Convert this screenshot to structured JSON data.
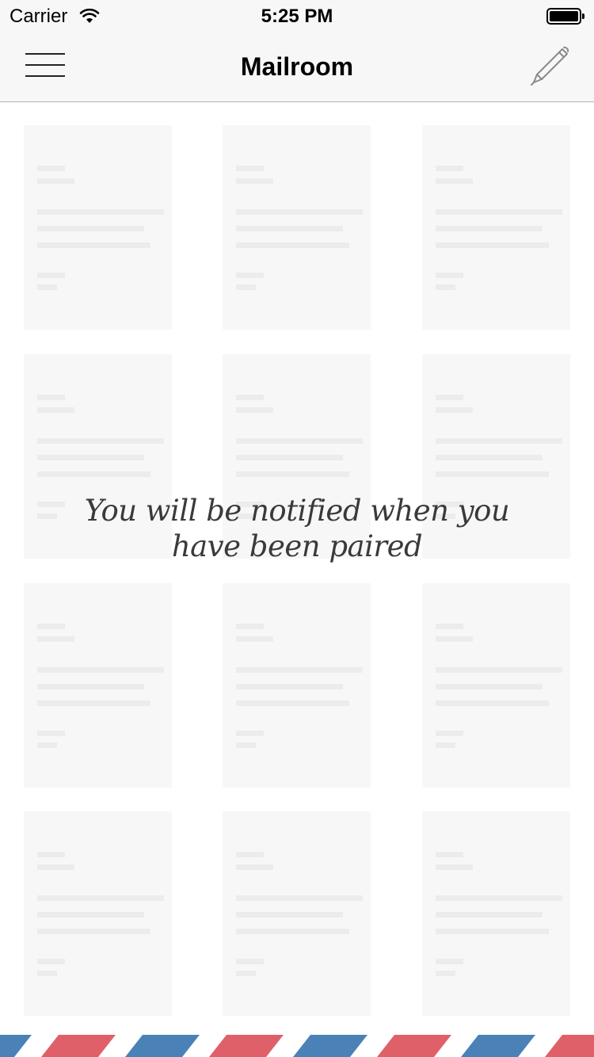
{
  "status_bar": {
    "carrier": "Carrier",
    "time": "5:25 PM",
    "wifi_icon": "wifi-icon",
    "battery_icon": "battery-full-icon"
  },
  "nav": {
    "title": "Mailroom",
    "menu_icon": "hamburger-menu-icon",
    "compose_icon": "pen-icon"
  },
  "empty_state": {
    "message": "You will be notified when you have been paired"
  },
  "placeholder_grid": {
    "rows": 4,
    "columns": 3
  },
  "colors": {
    "nav_background": "#f7f7f7",
    "card_background": "#f7f7f7",
    "card_line": "#ececec",
    "airmail_red": "#e0606a",
    "airmail_blue": "#4a82b8",
    "message_text": "#3a3a3a"
  }
}
